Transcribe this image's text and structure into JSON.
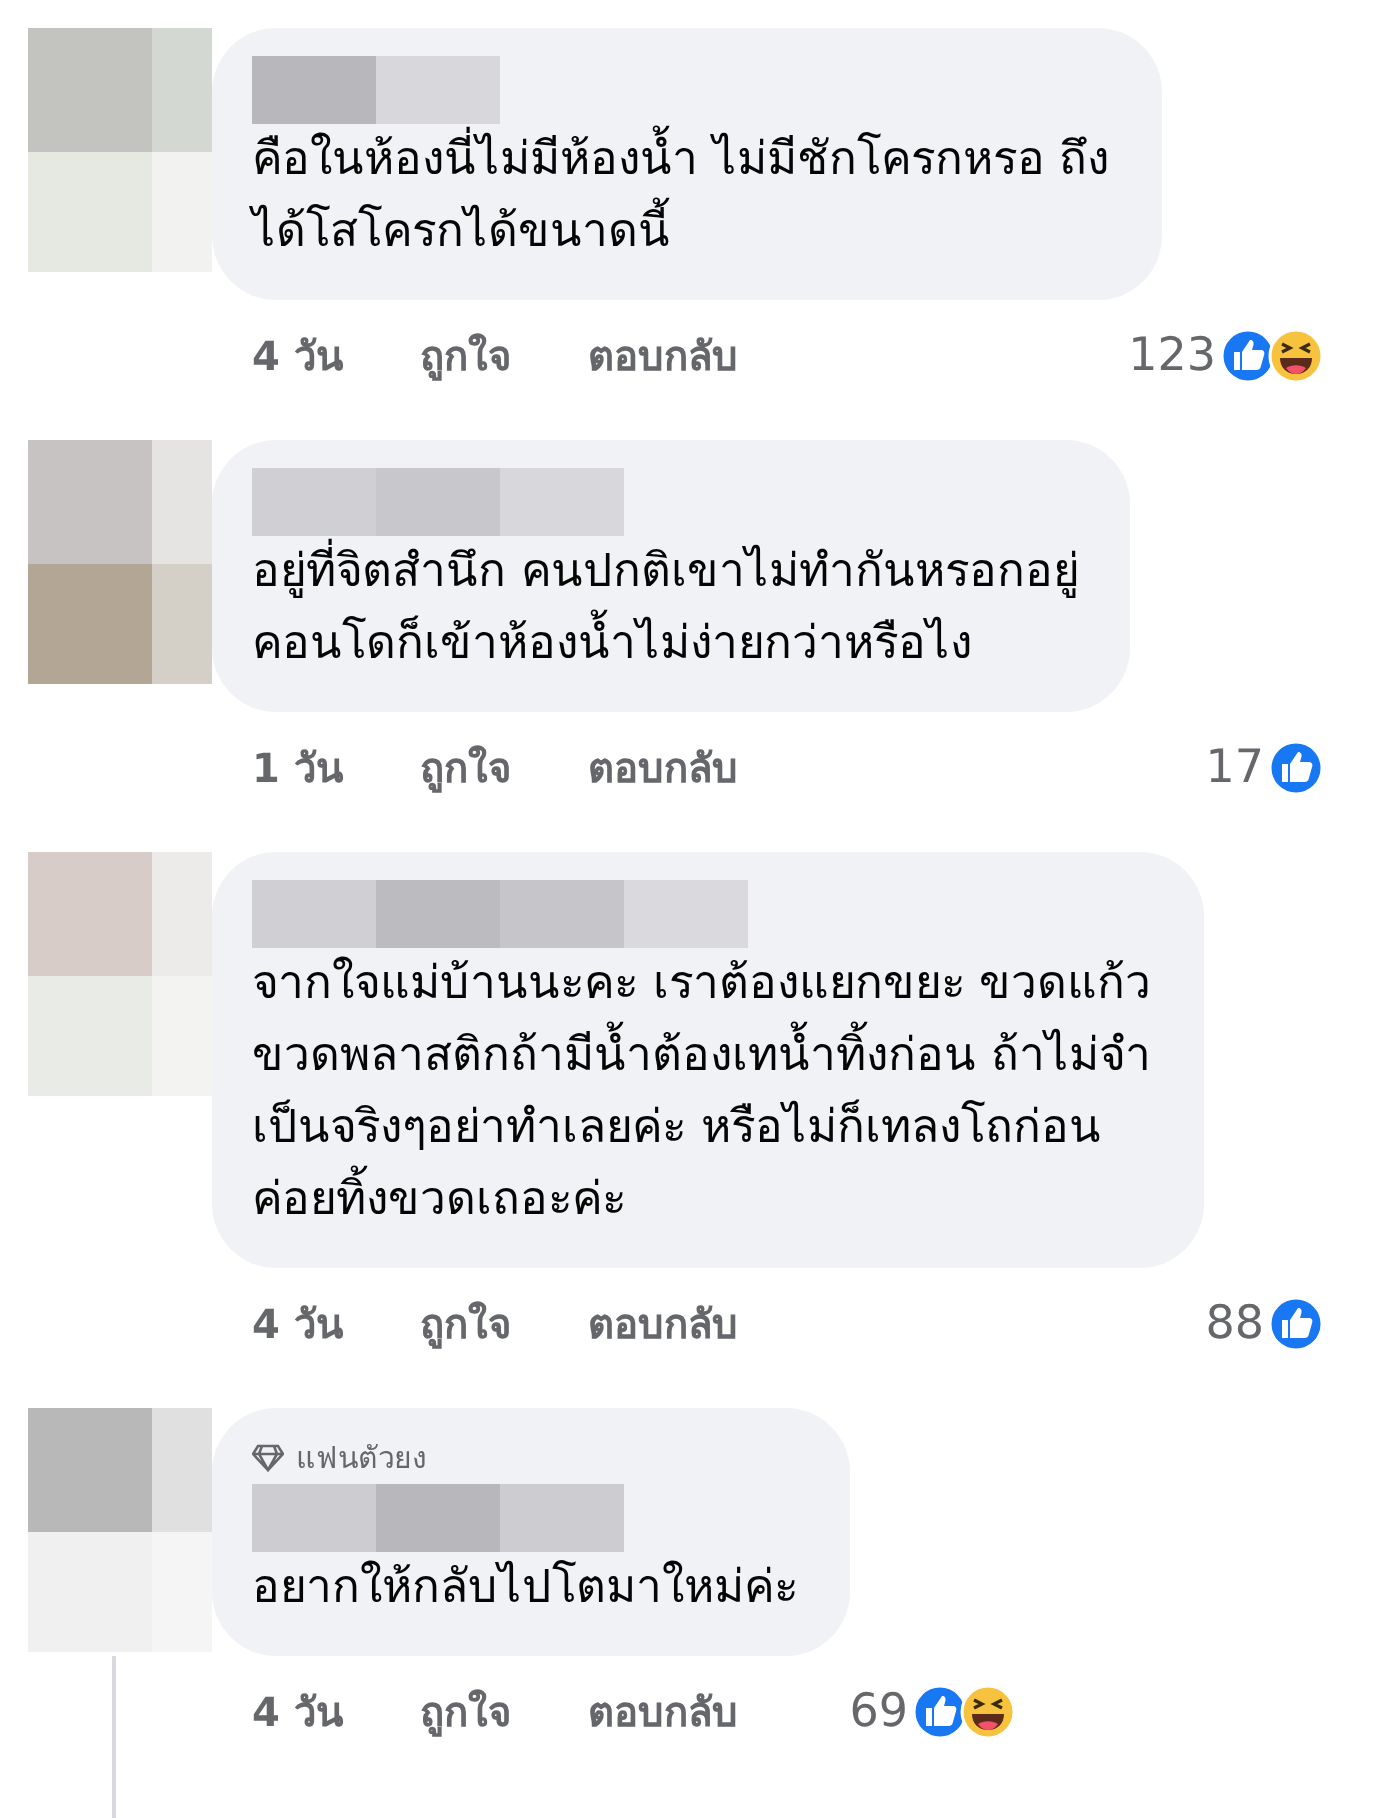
{
  "comments": [
    {
      "text": "คือในห้องนี่ไม่มีห้องน้ำ ไม่มีชักโครกหรอ ถึง\nได้โสโครกได้ขนาดนี้",
      "time": "4 วัน",
      "like": "ถูกใจ",
      "reply": "ตอบกลับ",
      "count": "123",
      "reactions": [
        {
          "kind": "like"
        },
        {
          "kind": "haha"
        }
      ],
      "has_replies": false
    },
    {
      "text": "อยู่ที่จิตสำนึก คนปกติเขาไม่ทำกันหรอกอยู่\nคอนโดก็เข้าห้องน้ำไม่ง่ายกว่าหรือไง",
      "time": "1 วัน",
      "like": "ถูกใจ",
      "reply": "ตอบกลับ",
      "count": "17",
      "reactions": [
        {
          "kind": "like"
        }
      ],
      "has_replies": false
    },
    {
      "text": "จากใจแม่บ้านนะคะ เราต้องแยกขยะ ขวดแก้ว\nขวดพลาสติกถ้ามีน้ำต้องเทน้ำทิ้งก่อน ถ้าไม่จำ\nเป็นจริงๆอย่าทำเลยค่ะ หรือไม่ก็เทลงโถก่อน\nค่อยทิ้งขวดเถอะค่ะ",
      "time": "4 วัน",
      "like": "ถูกใจ",
      "reply": "ตอบกลับ",
      "count": "88",
      "reactions": [
        {
          "kind": "like"
        }
      ],
      "has_replies": false
    },
    {
      "badge": "แฟนตัวยง",
      "text": "อยากให้กลับไปโตมาใหม่ค่ะ",
      "time": "4 วัน",
      "like": "ถูกใจ",
      "reply": "ตอบกลับ",
      "count": "69",
      "reactions": [
        {
          "kind": "like"
        },
        {
          "kind": "haha"
        }
      ],
      "has_replies": true
    }
  ]
}
